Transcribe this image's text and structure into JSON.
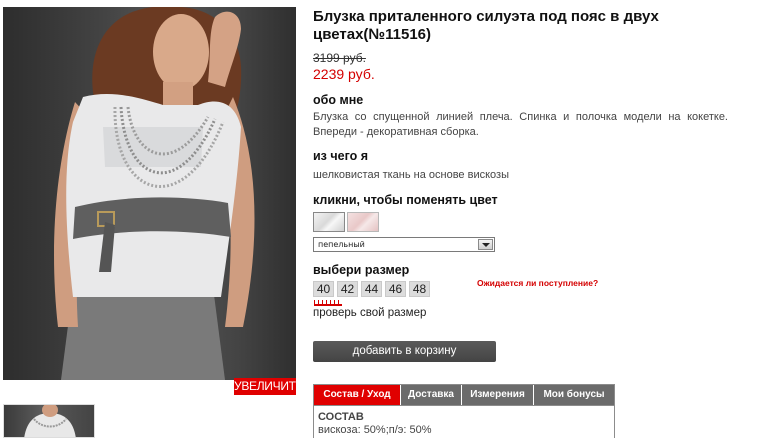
{
  "product": {
    "title": "Блузка приталенного силуэта под пояс в двух цветах(№11516)",
    "old_price": "3199 руб.",
    "new_price": "2239 руб."
  },
  "image": {
    "zoom_label": "УВЕЛИЧИТЬ"
  },
  "about": {
    "heading": "обо мне",
    "text": "Блузка со спущенной линией плеча. Спинка и полочка модели на кокетке. Впереди - декоративная сборка."
  },
  "material": {
    "heading": "из чего я",
    "text": "шелковистая ткань на основе вискозы"
  },
  "color": {
    "heading": "кликни, чтобы поменять цвет",
    "selected": "пепельный",
    "swatches": [
      "grey",
      "pink"
    ]
  },
  "size": {
    "heading": "выбери размер",
    "options": [
      "40",
      "42",
      "44",
      "46",
      "48"
    ],
    "await_link": "Ожидается ли поступление?",
    "check_size": "проверь свой размер"
  },
  "cart": {
    "button_label": "добавить в корзину"
  },
  "tabs": {
    "items": [
      "Состав / Уход",
      "Доставка",
      "Измерения",
      "Мои бонусы"
    ],
    "active": 0,
    "content_title": "СОСТАВ",
    "content_text": "вискоза: 50%;п/э: 50%"
  },
  "colors": {
    "accent": "#e00000",
    "price": "#d40000",
    "dark_button": "#4e4e4e"
  }
}
